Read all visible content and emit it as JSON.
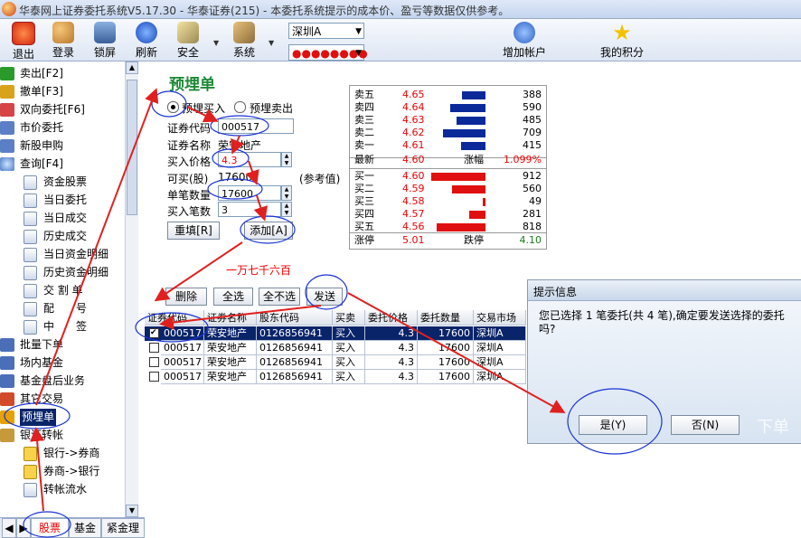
{
  "window": {
    "title": "华泰网上证券委托系统V5.17.30 - 华泰证券(215) - 本委托系统提示的成本价、盈亏等数据仅供参考。"
  },
  "toolbar": {
    "buttons": [
      "退出",
      "登录",
      "锁屏",
      "刷新",
      "安全",
      "系统",
      "增加帐户",
      "我的积分"
    ],
    "market_select": "深圳A",
    "account_select": "●●●●●●●●"
  },
  "sidebar": {
    "items": [
      "卖出[F2]",
      "撤单[F3]",
      "双向委托[F6]",
      "市价委托",
      "新股申购",
      "查询[F4]"
    ],
    "query_sub": [
      "资金股票",
      "当日委托",
      "当日成交",
      "历史成交",
      "当日资金明细",
      "历史资金明细",
      "交 割 单",
      "配　　号",
      "中　　签"
    ],
    "items2": [
      "批量下单",
      "场内基金",
      "基金盘后业务",
      "其它交易",
      "预埋单",
      "银证转帐"
    ],
    "transfer_sub": [
      "银行->券商",
      "券商->银行",
      "转帐流水"
    ],
    "bottom_tabs": [
      "股票",
      "基金",
      "紧金理"
    ]
  },
  "form": {
    "title": "预埋单",
    "radio_buy": "预埋买入",
    "radio_sell": "预埋卖出",
    "code_label": "证券代码",
    "code_value": "000517",
    "name_label": "证券名称",
    "name_value": "荣安地产",
    "price_label": "买入价格",
    "price_value": "4.3",
    "avail_label": "可买(股)",
    "avail_value": "17600",
    "ref_label": "(参考值)",
    "qty_label": "单笔数量",
    "qty_value": "17600",
    "count_label": "买入笔数",
    "count_value": "3",
    "reset_button": "重填[R]",
    "add_button": "添加[A]",
    "amount_cn": "一万七千六百"
  },
  "quote": {
    "sells": [
      {
        "name": "卖五",
        "price": "4.65",
        "vol": "388"
      },
      {
        "name": "卖四",
        "price": "4.64",
        "vol": "590"
      },
      {
        "name": "卖三",
        "price": "4.63",
        "vol": "485"
      },
      {
        "name": "卖二",
        "price": "4.62",
        "vol": "709"
      },
      {
        "name": "卖一",
        "price": "4.61",
        "vol": "415"
      }
    ],
    "last_label": "最新",
    "last": "4.60",
    "chg_label": "涨幅",
    "chg": "1.099%",
    "buys": [
      {
        "name": "买一",
        "price": "4.60",
        "vol": "912"
      },
      {
        "name": "买二",
        "price": "4.59",
        "vol": "560"
      },
      {
        "name": "买三",
        "price": "4.58",
        "vol": "49"
      },
      {
        "name": "买四",
        "price": "4.57",
        "vol": "281"
      },
      {
        "name": "买五",
        "price": "4.56",
        "vol": "818"
      }
    ],
    "limit_up_label": "涨停",
    "limit_up": "5.01",
    "limit_down_label": "跌停",
    "limit_down": "4.10"
  },
  "actions": {
    "delete": "删除",
    "select_all": "全选",
    "select_none": "全不选",
    "send": "发送"
  },
  "table": {
    "headers": [
      "证券代码",
      "证券名称",
      "股东代码",
      "买卖",
      "委托价格",
      "委托数量",
      "交易市场"
    ],
    "rows": [
      [
        "000517",
        "荣安地产",
        "0126856941",
        "买入",
        "4.3",
        "17600",
        "深圳A"
      ],
      [
        "000517",
        "荣安地产",
        "0126856941",
        "买入",
        "4.3",
        "17600",
        "深圳A"
      ],
      [
        "000517",
        "荣安地产",
        "0126856941",
        "买入",
        "4.3",
        "17600",
        "深圳A"
      ],
      [
        "000517",
        "荣安地产",
        "0126856941",
        "买入",
        "4.3",
        "17600",
        "深圳A"
      ]
    ]
  },
  "dialog": {
    "title": "提示信息",
    "message": "您已选择 1 笔委托(共 4 笔),确定要发送选择的委托吗?",
    "yes": "是(Y)",
    "no": "否(N)",
    "watermark": "下单"
  },
  "colors": {
    "annotation": "#e02020",
    "circle": "#1a33d6",
    "sell_bar": "#0a2a9a",
    "buy_bar": "#e01010",
    "title_green": "#1e8a37"
  }
}
